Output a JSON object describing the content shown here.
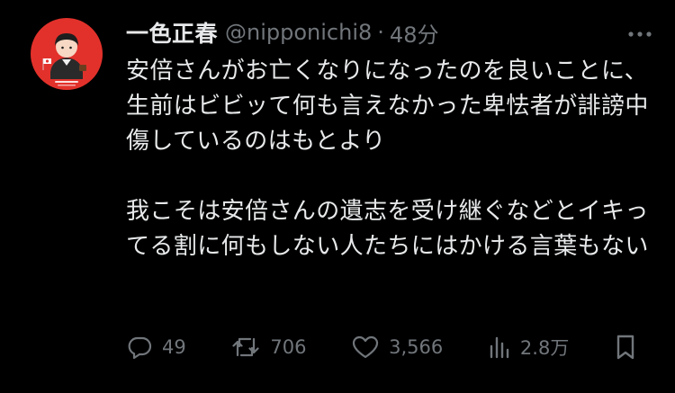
{
  "author": {
    "display_name": "一色正春",
    "handle": "@nipponichi8",
    "separator": "·",
    "time": "48分",
    "avatar_color": "#e2312b"
  },
  "post": {
    "paragraph1": "安倍さんがお亡くなりになったのを良いことに、生前はビビッて何も言えなかった卑怯者が誹謗中傷しているのはもとより",
    "paragraph2": "我こそは安倍さんの遺志を受け継ぐなどとイキってる割に何もしない人たちにはかける言葉もない"
  },
  "actions": {
    "replies": "49",
    "reposts": "706",
    "likes": "3,566",
    "views": "2.8万"
  },
  "icons": {
    "more": "more-dots-icon",
    "reply": "reply-bubble-icon",
    "repost": "repost-arrows-icon",
    "like": "heart-icon",
    "views": "bar-chart-icon",
    "bookmark": "bookmark-icon"
  },
  "colors": {
    "background": "#000000",
    "text_primary": "#e7e9ea",
    "text_secondary": "#71767b"
  }
}
